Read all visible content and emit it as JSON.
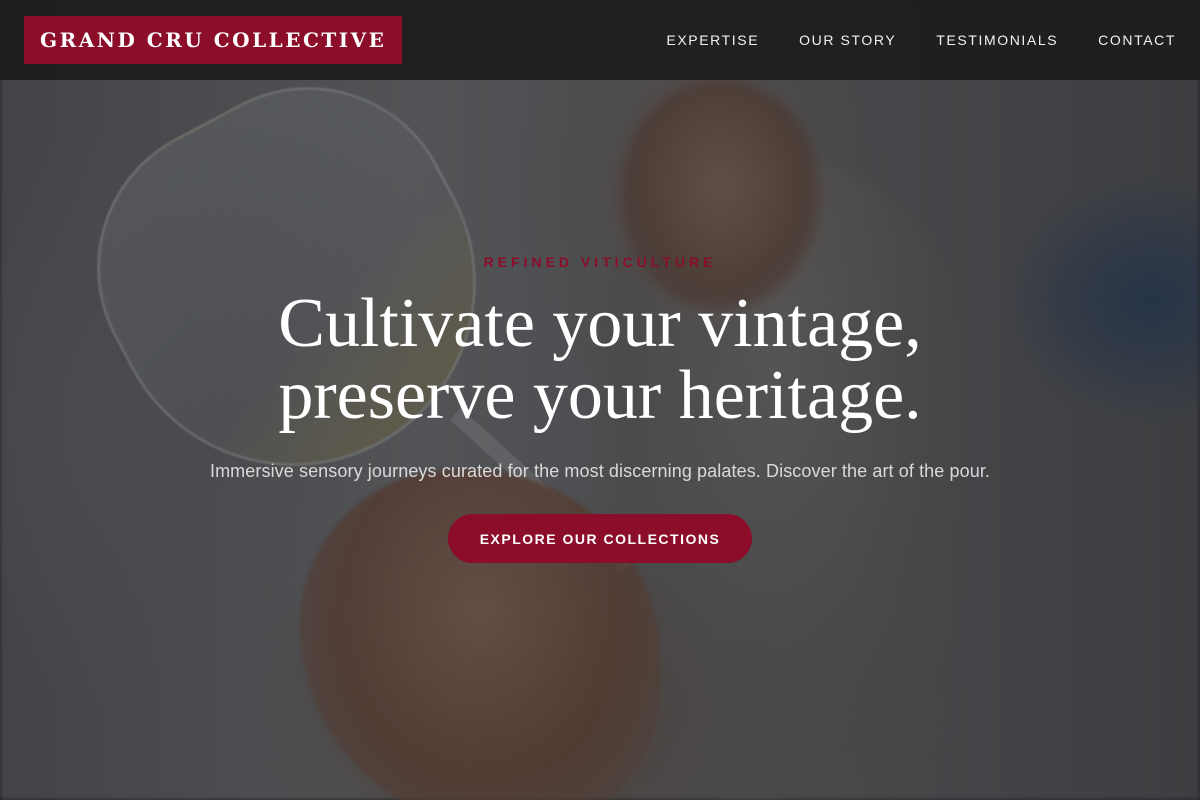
{
  "header": {
    "brand": "GRAND CRU COLLECTIVE",
    "nav": [
      {
        "label": "EXPERTISE"
      },
      {
        "label": "OUR STORY"
      },
      {
        "label": "TESTIMONIALS"
      },
      {
        "label": "CONTACT"
      }
    ]
  },
  "hero": {
    "eyebrow": "REFINED VITICULTURE",
    "headline_line1": "Cultivate your vintage,",
    "headline_line2": "preserve your heritage.",
    "subtitle": "Immersive sensory journeys curated for the most discerning palates. Discover the art of the pour.",
    "cta_label": "EXPLORE OUR COLLECTIONS"
  },
  "colors": {
    "brand_accent": "#8b0d2a",
    "header_bg": "#1e1e1e",
    "text_light": "#ffffff"
  }
}
